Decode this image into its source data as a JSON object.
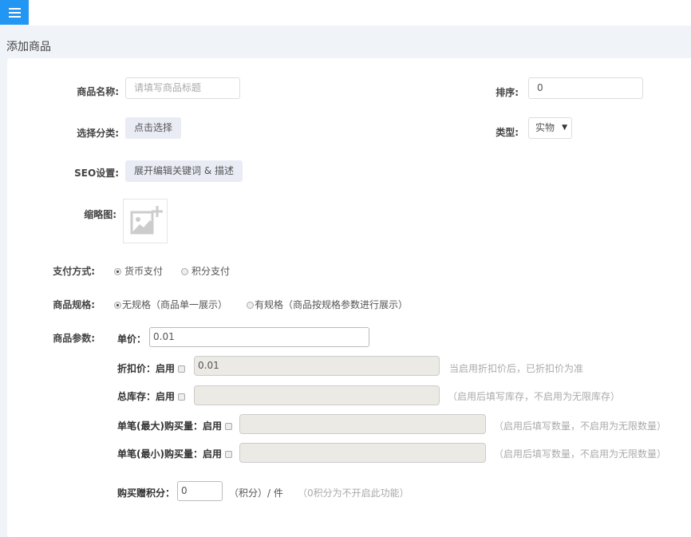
{
  "header": {
    "menu_icon": "hamburger-icon",
    "page_title": "添加商品"
  },
  "form": {
    "name": {
      "label": "商品名称:",
      "placeholder": "请填写商品标题"
    },
    "sort": {
      "label": "排序:",
      "value": "0"
    },
    "category": {
      "label": "选择分类:",
      "button": "点击选择"
    },
    "type": {
      "label": "类型:",
      "value": "实物"
    },
    "seo": {
      "label": "SEO设置:",
      "button": "展开编辑关键词 & 描述"
    },
    "thumb": {
      "label": "缩略图:",
      "icon": "add-image-icon"
    },
    "payment": {
      "label": "支付方式:",
      "options": [
        "货币支付",
        "积分支付"
      ],
      "selected": 0
    },
    "spec": {
      "label": "商品规格:",
      "options": [
        "无规格（商品单一展示）",
        "有规格（商品按规格参数进行展示）"
      ],
      "selected": 0
    },
    "params": {
      "label": "商品参数:",
      "price": {
        "label": "单价：",
        "value": "0.01"
      },
      "discount": {
        "label": "折扣价：启用",
        "value": "0.01",
        "hint": "当启用折扣价后，已折扣价为准"
      },
      "stock": {
        "label": "总库存：启用",
        "value": "",
        "hint": "（启用后填写库存，不启用为无限库存）"
      },
      "max_buy": {
        "label": "单笔(最大)购买量：启用",
        "value": "",
        "hint": "（启用后填写数量，不启用为无限数量）"
      },
      "min_buy": {
        "label": "单笔(最小)购买量：启用",
        "value": "",
        "hint": "（启用后填写数量，不启用为无限数量）"
      },
      "points": {
        "label": "购买赠积分：",
        "value": "0",
        "unit": "（积分）/ 件",
        "hint": "（0积分为不开启此功能）"
      }
    }
  }
}
